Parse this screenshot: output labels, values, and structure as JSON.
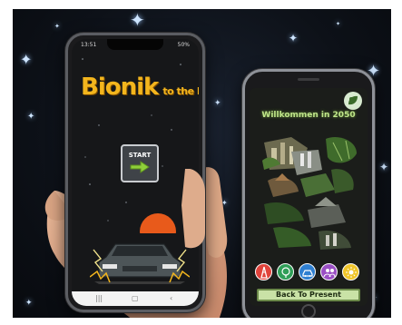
{
  "phone_left": {
    "status_time": "13:51",
    "status_battery": "50%",
    "title_main": "Bionik",
    "title_rest": "to the Future",
    "start_label": "START",
    "nav_icons": [
      "recents-icon",
      "home-icon",
      "back-icon"
    ]
  },
  "phone_right": {
    "title": "Willkommen in 2050",
    "back_button_label": "Back To Present",
    "category_icons": [
      {
        "name": "tower-icon",
        "color": "#e0433b"
      },
      {
        "name": "nature-icon",
        "color": "#2f9e57"
      },
      {
        "name": "car-icon",
        "color": "#2f7fd0"
      },
      {
        "name": "people-icon",
        "color": "#9a4fc4"
      },
      {
        "name": "sun-icon",
        "color": "#f0c52a"
      }
    ]
  },
  "colors": {
    "title_yellow": "#f3b51d",
    "sun_orange": "#e85a1b",
    "welcome_green": "#bfe58a",
    "button_green": "#c9e2a6"
  }
}
